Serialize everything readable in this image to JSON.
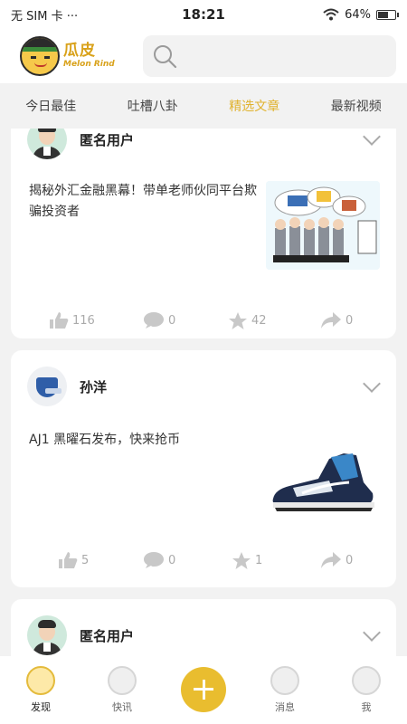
{
  "status_bar": {
    "carrier": "无 SIM 卡 ···",
    "time": "18:21",
    "battery": "64%",
    "battery_level": 0.64
  },
  "header": {
    "logo_cn": "瓜皮",
    "logo_en": "Melon Rind",
    "search_placeholder": ""
  },
  "tabs": [
    {
      "label": "今日最佳"
    },
    {
      "label": "吐槽八卦"
    },
    {
      "label": "精选文章",
      "active": true
    },
    {
      "label": "最新视频"
    }
  ],
  "posts": [
    {
      "author": "匿名用户",
      "text": "揭秘外汇金融黑幕！带单老师伙同平台欺骗投资者",
      "image": "cartoon-illustration",
      "likes": "116",
      "comments": "0",
      "stars": "42",
      "shares": "0"
    },
    {
      "author": "孙洋",
      "text": "AJ1 黑曜石发布，快来抢币",
      "image": "sneaker-photo",
      "likes": "5",
      "comments": "0",
      "stars": "1",
      "shares": "0"
    },
    {
      "author": "匿名用户"
    }
  ],
  "bottom_nav": [
    {
      "label": "发现",
      "active": true
    },
    {
      "label": "快讯"
    },
    {
      "label": ""
    },
    {
      "label": "消息"
    },
    {
      "label": "我"
    }
  ],
  "colors": {
    "accent": "#e9bd2f",
    "tab_active": "#e0b22e",
    "background": "#f2f2f2"
  }
}
